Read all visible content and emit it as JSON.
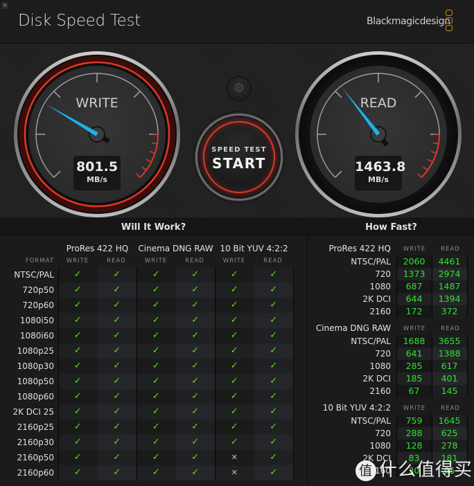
{
  "window": {
    "close_icon": "×",
    "title": "Disk Speed Test",
    "brand": "Blackmagicdesign"
  },
  "gauges": {
    "write": {
      "label": "WRITE",
      "value": "801.5",
      "unit": "MB/s",
      "needle_fraction": 0.28
    },
    "read": {
      "label": "READ",
      "value": "1463.8",
      "unit": "MB/s",
      "needle_fraction": 0.36
    }
  },
  "controls": {
    "settings_icon": "⚙",
    "start_line1": "SPEED TEST",
    "start_line2": "START"
  },
  "will_it_work": {
    "title": "Will It Work?",
    "format_label": "FORMAT",
    "codecs": [
      "ProRes 422 HQ",
      "Cinema DNG RAW",
      "10 Bit YUV 4:2:2"
    ],
    "sub_labels": [
      "WRITE",
      "READ"
    ],
    "yes_glyph": "✓",
    "no_glyph": "✕",
    "rows": [
      {
        "format": "NTSC/PAL",
        "results": [
          true,
          true,
          true,
          true,
          true,
          true
        ]
      },
      {
        "format": "720p50",
        "results": [
          true,
          true,
          true,
          true,
          true,
          true
        ]
      },
      {
        "format": "720p60",
        "results": [
          true,
          true,
          true,
          true,
          true,
          true
        ]
      },
      {
        "format": "1080i50",
        "results": [
          true,
          true,
          true,
          true,
          true,
          true
        ]
      },
      {
        "format": "1080i60",
        "results": [
          true,
          true,
          true,
          true,
          true,
          true
        ]
      },
      {
        "format": "1080p25",
        "results": [
          true,
          true,
          true,
          true,
          true,
          true
        ]
      },
      {
        "format": "1080p30",
        "results": [
          true,
          true,
          true,
          true,
          true,
          true
        ]
      },
      {
        "format": "1080p50",
        "results": [
          true,
          true,
          true,
          true,
          true,
          true
        ]
      },
      {
        "format": "1080p60",
        "results": [
          true,
          true,
          true,
          true,
          true,
          true
        ]
      },
      {
        "format": "2K DCI 25",
        "results": [
          true,
          true,
          true,
          true,
          true,
          true
        ]
      },
      {
        "format": "2160p25",
        "results": [
          true,
          true,
          true,
          true,
          true,
          true
        ]
      },
      {
        "format": "2160p30",
        "results": [
          true,
          true,
          true,
          true,
          true,
          true
        ]
      },
      {
        "format": "2160p50",
        "results": [
          true,
          true,
          true,
          true,
          false,
          true
        ]
      },
      {
        "format": "2160p60",
        "results": [
          true,
          true,
          true,
          true,
          false,
          true
        ]
      }
    ]
  },
  "how_fast": {
    "title": "How Fast?",
    "sub_labels": [
      "WRITE",
      "READ"
    ],
    "sections": [
      {
        "codec": "ProRes 422 HQ",
        "rows": [
          {
            "format": "NTSC/PAL",
            "write": "2060",
            "read": "4461"
          },
          {
            "format": "720",
            "write": "1373",
            "read": "2974"
          },
          {
            "format": "1080",
            "write": "687",
            "read": "1487"
          },
          {
            "format": "2K DCI",
            "write": "644",
            "read": "1394"
          },
          {
            "format": "2160",
            "write": "172",
            "read": "372"
          }
        ]
      },
      {
        "codec": "Cinema DNG RAW",
        "rows": [
          {
            "format": "NTSC/PAL",
            "write": "1688",
            "read": "3655"
          },
          {
            "format": "720",
            "write": "641",
            "read": "1388"
          },
          {
            "format": "1080",
            "write": "285",
            "read": "617"
          },
          {
            "format": "2K DCI",
            "write": "185",
            "read": "401"
          },
          {
            "format": "2160",
            "write": "67",
            "read": "145"
          }
        ]
      },
      {
        "codec": "10 Bit YUV 4:2:2",
        "rows": [
          {
            "format": "NTSC/PAL",
            "write": "759",
            "read": "1645"
          },
          {
            "format": "720",
            "write": "288",
            "read": "625"
          },
          {
            "format": "1080",
            "write": "128",
            "read": "278"
          },
          {
            "format": "2K DCI",
            "write": "83",
            "read": "181"
          },
          {
            "format": "2160",
            "write": "30",
            "read": "65"
          }
        ]
      }
    ]
  },
  "watermark": {
    "badge": "值",
    "text": "什么值得买"
  }
}
